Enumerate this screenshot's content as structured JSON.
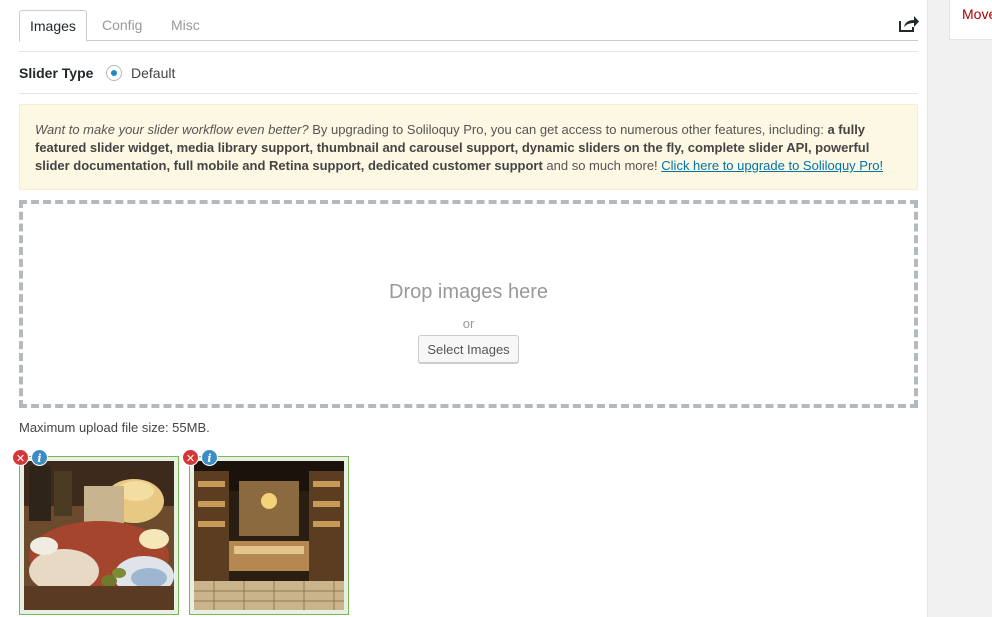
{
  "tabs": [
    {
      "label": "Images",
      "active": true
    },
    {
      "label": "Config",
      "active": false
    },
    {
      "label": "Misc",
      "active": false
    }
  ],
  "share_icon": "share-arrow-icon",
  "side": {
    "link": "Move"
  },
  "slider_type": {
    "label": "Slider Type",
    "option": "Default",
    "selected": true
  },
  "notice": {
    "intro_italic": "Want to make your slider workflow even better?",
    "intro_text": " By upgrading to Soliloquy Pro, you can get access to numerous other features, including: ",
    "features_bold": "a fully featured slider widget, media library support, thumbnail and carousel support, dynamic sliders on the fly, complete slider API, powerful slider documentation, full mobile and Retina support, dedicated customer support",
    "outro": " and so much more! ",
    "link": "Click here to upgrade to Soliloquy Pro!"
  },
  "dropzone": {
    "title": "Drop images here",
    "or": "or",
    "button": "Select Images"
  },
  "max_upload": "Maximum upload file size: 55MB.",
  "thumbnails": [
    {
      "name": "cheese-and-charcuterie-photo",
      "remove_icon": "remove-x-icon",
      "info_icon": "info-icon"
    },
    {
      "name": "deli-shop-interior-photo",
      "remove_icon": "remove-x-icon",
      "info_icon": "info-icon"
    }
  ],
  "colors": {
    "accent": "#0073aa",
    "notice_bg": "#fcf8e3",
    "thumb_border": "#7ab55c",
    "remove": "#d63638",
    "info": "#3c8dc5"
  }
}
